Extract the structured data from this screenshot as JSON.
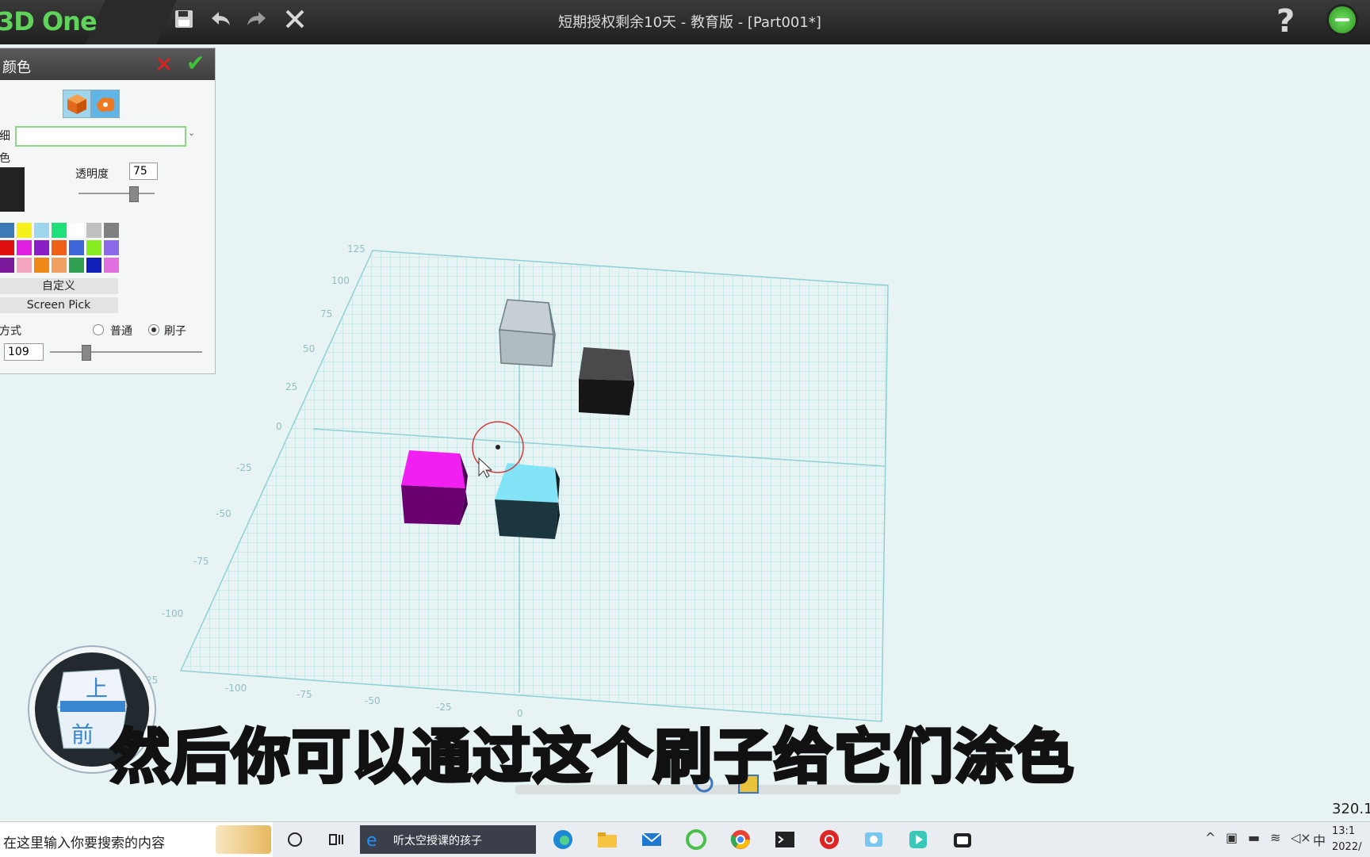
{
  "app": {
    "logo": "3D One",
    "title": "短期授权剩余10天 - 教育版 - [Part001*]",
    "help": "?"
  },
  "toolbar": {
    "icons": [
      "save-icon",
      "undo-icon",
      "redo-icon",
      "close-icon"
    ]
  },
  "color_panel": {
    "title": "颜色",
    "label_fine": "细",
    "label_color": "色",
    "transparency_label": "透明度",
    "transparency_value": "75",
    "transparency_level": 0.75,
    "custom_button": "自定义",
    "screen_pick_button": "Screen Pick",
    "method_label": "方式",
    "option_normal": "普通",
    "option_brush": "刷子",
    "selected_option": "刷子",
    "brush_size": "109",
    "current_color": "#222222",
    "palette": [
      [
        "#3d79b4",
        "#f4f21a",
        "#9ed6ee",
        "#1fe07a",
        "#ffffff",
        "#c0c0c0",
        "#808080"
      ],
      [
        "#e01010",
        "#e020e0",
        "#8c1ec8",
        "#f06018",
        "#3d66d8",
        "#88ec22",
        "#8a6ae8"
      ],
      [
        "#7a1a9a",
        "#f4a6c0",
        "#f08818",
        "#f0a060",
        "#2ea050",
        "#1020b8",
        "#e070e0"
      ]
    ]
  },
  "viewport": {
    "y_ticks": [
      "125",
      "100",
      "75",
      "50",
      "25",
      "0",
      "-25",
      "-50",
      "-75",
      "-100",
      "-125"
    ],
    "x_ticks": [
      "-100",
      "-75",
      "-50",
      "-25",
      "0"
    ],
    "view_cube_top": "上",
    "view_cube_front": "前",
    "cubes": [
      {
        "name": "transparent-cube",
        "color": "#b8c4c8"
      },
      {
        "name": "black-cube",
        "color": "#1e1e1e"
      },
      {
        "name": "magenta-cube",
        "color": "#e010e0"
      },
      {
        "name": "cyan-cube",
        "color": "#7ee0f4"
      }
    ]
  },
  "subtitle": "然后你可以通过这个刷子给它们涂色",
  "coordinate_readout": "320.1",
  "taskbar": {
    "search_placeholder": "在这里输入你要搜索的内容",
    "ie_tab_label": "听太空授课的孩子",
    "ime_label": "中",
    "clock_time": "13:1",
    "clock_date": "2022/"
  }
}
